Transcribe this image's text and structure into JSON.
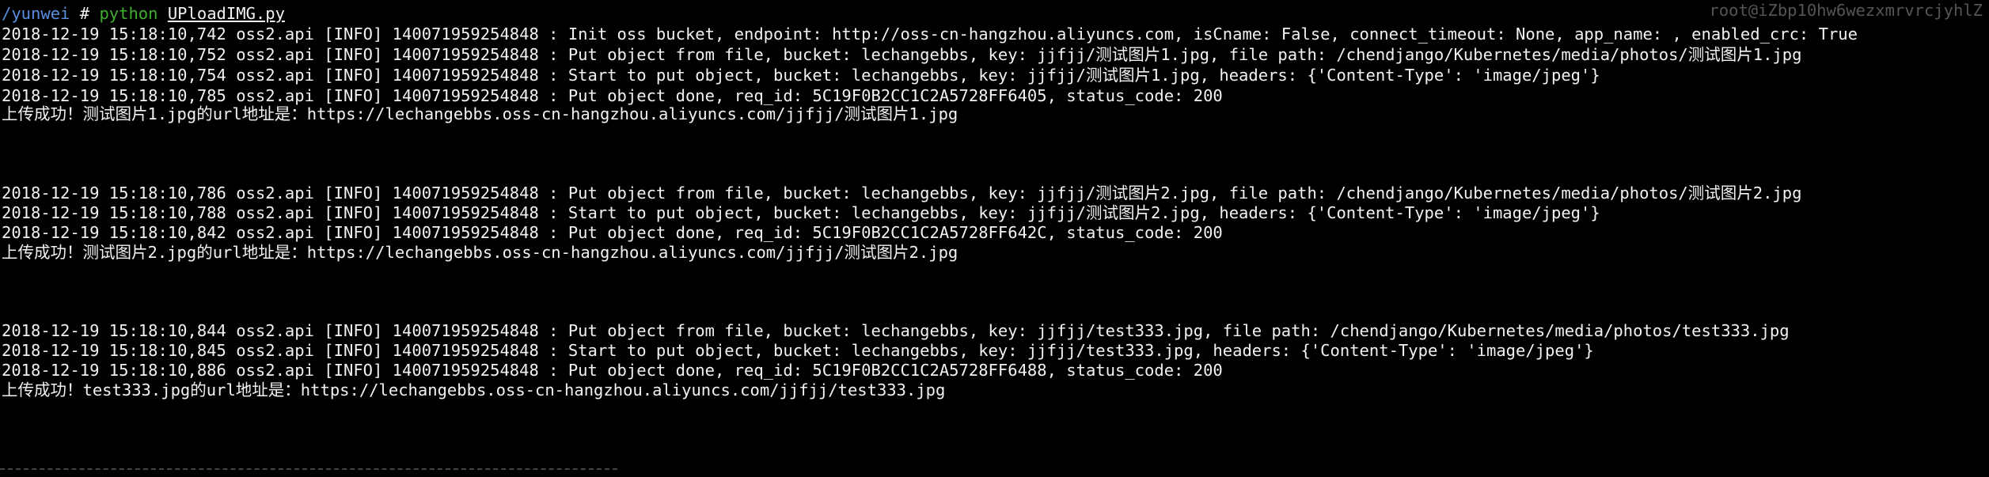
{
  "window": {
    "title_right": "root@iZbp10hw6wezxmrvrcjyhlZ"
  },
  "prompt": {
    "path": "/yunwei",
    "hash": "#",
    "command": "python",
    "argument": "UPloadIMG.py"
  },
  "output": [
    "2018-12-19 15:18:10,742 oss2.api [INFO] 140071959254848 : Init oss bucket, endpoint: http://oss-cn-hangzhou.aliyuncs.com, isCname: False, connect_timeout: None, app_name: , enabled_crc: True",
    "2018-12-19 15:18:10,752 oss2.api [INFO] 140071959254848 : Put object from file, bucket: lechangebbs, key: jjfjj/测试图片1.jpg, file path: /chendjango/Kubernetes/media/photos/测试图片1.jpg",
    "2018-12-19 15:18:10,754 oss2.api [INFO] 140071959254848 : Start to put object, bucket: lechangebbs, key: jjfjj/测试图片1.jpg, headers: {'Content-Type': 'image/jpeg'}",
    "2018-12-19 15:18:10,785 oss2.api [INFO] 140071959254848 : Put object done, req_id: 5C19F0B2CC1C2A5728FF6405, status_code: 200",
    "上传成功！测试图片1.jpg的url地址是：https://lechangebbs.oss-cn-hangzhou.aliyuncs.com/jjfjj/测试图片1.jpg",
    "2018-12-19 15:18:10,786 oss2.api [INFO] 140071959254848 : Put object from file, bucket: lechangebbs, key: jjfjj/测试图片2.jpg, file path: /chendjango/Kubernetes/media/photos/测试图片2.jpg",
    "2018-12-19 15:18:10,788 oss2.api [INFO] 140071959254848 : Start to put object, bucket: lechangebbs, key: jjfjj/测试图片2.jpg, headers: {'Content-Type': 'image/jpeg'}",
    "2018-12-19 15:18:10,842 oss2.api [INFO] 140071959254848 : Put object done, req_id: 5C19F0B2CC1C2A5728FF642C, status_code: 200",
    "上传成功！测试图片2.jpg的url地址是：https://lechangebbs.oss-cn-hangzhou.aliyuncs.com/jjfjj/测试图片2.jpg",
    "2018-12-19 15:18:10,844 oss2.api [INFO] 140071959254848 : Put object from file, bucket: lechangebbs, key: jjfjj/test333.jpg, file path: /chendjango/Kubernetes/media/photos/test333.jpg",
    "2018-12-19 15:18:10,845 oss2.api [INFO] 140071959254848 : Start to put object, bucket: lechangebbs, key: jjfjj/test333.jpg, headers: {'Content-Type': 'image/jpeg'}",
    "2018-12-19 15:18:10,886 oss2.api [INFO] 140071959254848 : Put object done, req_id: 5C19F0B2CC1C2A5728FF6488, status_code: 200",
    "上传成功！test333.jpg的url地址是：https://lechangebbs.oss-cn-hangzhou.aliyuncs.com/jjfjj/test333.jpg"
  ],
  "colors": {
    "background": "#000000",
    "text": "#f2f2f2",
    "prompt_path": "#5a8fe0",
    "prompt_command": "#3fae2f"
  }
}
